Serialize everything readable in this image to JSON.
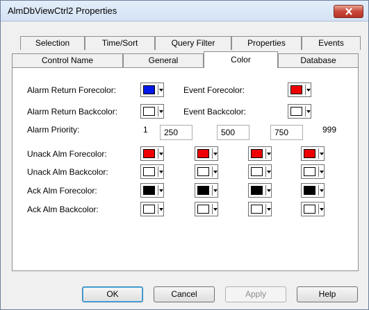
{
  "window": {
    "title": "AlmDbViewCtrl2 Properties"
  },
  "tabs": {
    "top_row": [
      "Selection",
      "Time/Sort",
      "Query Filter",
      "Properties",
      "Events"
    ],
    "bottom_row": [
      "Control Name",
      "General",
      "Color",
      "Database"
    ],
    "active": "Color"
  },
  "labels": {
    "alarm_return_fore": "Alarm Return Forecolor:",
    "alarm_return_back": "Alarm Return Backcolor:",
    "event_fore": "Event Forecolor:",
    "event_back": "Event Backcolor:",
    "alarm_priority": "Alarm Priority:",
    "unack_fore": "Unack Alm Forecolor:",
    "unack_back": "Unack Alm Backcolor:",
    "ack_fore": "Ack Alm Forecolor:",
    "ack_back": "Ack Alm Backcolor:"
  },
  "priority": {
    "min": "1",
    "field_1": "250",
    "field_2": "500",
    "field_3": "750",
    "max": "999"
  },
  "colors": {
    "alarm_return_fore": "#0018e8",
    "alarm_return_back": "#ffffff",
    "event_fore": "#ee0000",
    "event_back": "#ffffff",
    "unack_fore": [
      "#ee0000",
      "#ee0000",
      "#ee0000",
      "#ee0000"
    ],
    "unack_back": [
      "#ffffff",
      "#ffffff",
      "#ffffff",
      "#ffffff"
    ],
    "ack_fore": [
      "#000000",
      "#000000",
      "#000000",
      "#000000"
    ],
    "ack_back": [
      "#ffffff",
      "#ffffff",
      "#ffffff",
      "#ffffff"
    ]
  },
  "buttons": {
    "ok": "OK",
    "cancel": "Cancel",
    "apply": "Apply",
    "help": "Help"
  },
  "icons": {
    "close": "close-x-icon",
    "dropdown": "chevron-down-icon"
  }
}
